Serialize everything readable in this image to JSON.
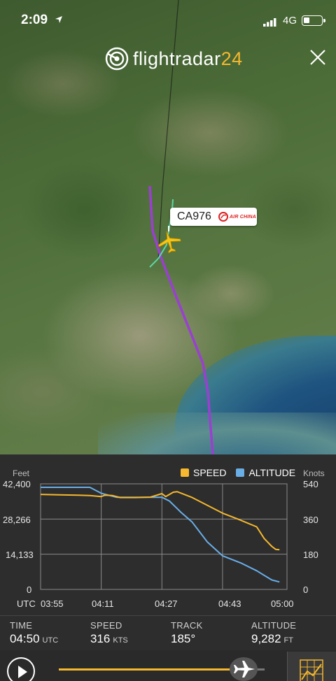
{
  "status_bar": {
    "time": "2:09",
    "network": "4G"
  },
  "app": {
    "brand_prefix": "flightradar",
    "brand_number": "24"
  },
  "flight": {
    "callsign": "CA976",
    "airline_name": "AIR CHINA"
  },
  "colors": {
    "speed": "#f5b82e",
    "altitude": "#6aaee8",
    "track": "#9b3fd1",
    "accent": "#f5b82e"
  },
  "chart_data": {
    "type": "line",
    "left_axis_title": "Feet",
    "right_axis_title": "Knots",
    "x_axis_title": "UTC",
    "x_ticks": [
      "03:55",
      "04:11",
      "04:27",
      "04:43",
      "05:00"
    ],
    "y_left_ticks": [
      "42,400",
      "28,266",
      "14,133",
      "0"
    ],
    "y_right_ticks": [
      "540",
      "360",
      "180",
      "0"
    ],
    "ylim_left": [
      0,
      42400
    ],
    "ylim_right": [
      0,
      540
    ],
    "x_minutes_range": [
      "03:55",
      "05:00"
    ],
    "grid": true,
    "legend_position": "top-right",
    "series": [
      {
        "name": "SPEED",
        "axis": "right",
        "points": [
          [
            "03:55",
            486
          ],
          [
            "04:00",
            484
          ],
          [
            "04:05",
            482
          ],
          [
            "04:08",
            480
          ],
          [
            "04:11",
            475
          ],
          [
            "04:12",
            482
          ],
          [
            "04:14",
            480
          ],
          [
            "04:16",
            470
          ],
          [
            "04:20",
            470
          ],
          [
            "04:24",
            472
          ],
          [
            "04:27",
            490
          ],
          [
            "04:28",
            475
          ],
          [
            "04:30",
            497
          ],
          [
            "04:31",
            500
          ],
          [
            "04:35",
            470
          ],
          [
            "04:38",
            440
          ],
          [
            "04:43",
            390
          ],
          [
            "04:47",
            360
          ],
          [
            "04:52",
            320
          ],
          [
            "04:54",
            260
          ],
          [
            "04:56",
            220
          ],
          [
            "04:57",
            205
          ],
          [
            "04:58",
            203
          ]
        ]
      },
      {
        "name": "ALTITUDE",
        "axis": "left",
        "points": [
          [
            "03:55",
            41000
          ],
          [
            "04:00",
            41000
          ],
          [
            "04:05",
            41000
          ],
          [
            "04:08",
            41000
          ],
          [
            "04:11",
            38600
          ],
          [
            "04:15",
            37000
          ],
          [
            "04:20",
            37000
          ],
          [
            "04:24",
            37000
          ],
          [
            "04:27",
            37000
          ],
          [
            "04:29",
            35500
          ],
          [
            "04:32",
            31000
          ],
          [
            "04:35",
            27000
          ],
          [
            "04:39",
            19000
          ],
          [
            "04:43",
            13500
          ],
          [
            "04:48",
            10500
          ],
          [
            "04:52",
            7500
          ],
          [
            "04:56",
            3800
          ],
          [
            "04:58",
            3000
          ]
        ]
      }
    ]
  },
  "stats": {
    "time": {
      "label": "TIME",
      "value": "04:50",
      "unit": "UTC"
    },
    "speed": {
      "label": "SPEED",
      "value": "316",
      "unit": "KTS"
    },
    "track": {
      "label": "TRACK",
      "value": "185°"
    },
    "altitude": {
      "label": "ALTITUDE",
      "value": "9,282",
      "unit": "FT"
    }
  },
  "playback": {
    "progress": 0.87
  }
}
